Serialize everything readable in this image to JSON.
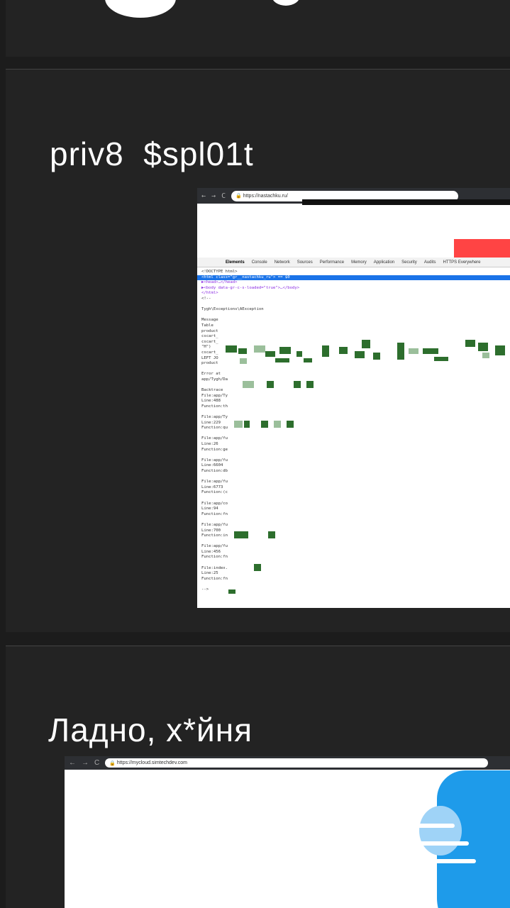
{
  "slide1": {
    "title": "priv8  $spl01t"
  },
  "slide2": {
    "title": "Ладно, х*йня"
  },
  "browser1": {
    "url": "https://nastachku.ru/",
    "devtools_tabs": [
      "Elements",
      "Console",
      "Network",
      "Sources",
      "Performance",
      "Memory",
      "Application",
      "Security",
      "Audits",
      "HTTPS Everywhere"
    ],
    "code_lines": [
      "<!DOCTYPE html>",
      "<html class=\"gr__nastachku_ru\"> == $0",
      "▶<head>…</head>",
      "▶<body data-gr-c-s-loaded=\"true\">…</body>",
      "</html>",
      "<!--",
      "",
      "Tygh\\Exceptions\\AException",
      "",
      "Message",
      "Table",
      "product",
      "cscart_",
      "cscart_",
      "\"H\")",
      "cscart_",
      "LEFT JO",
      "product",
      "",
      "Error at",
      "app/Tygh/Da",
      "",
      "Backtrace",
      "File:app/Ty",
      "Line:488",
      "Function:th",
      "",
      "File:app/Ty",
      "Line:229",
      "Function:qu",
      "",
      "File:app/fu",
      "Line:26",
      "Function:ge",
      "",
      "File:app/fu",
      "Line:6604",
      "Function:db",
      "",
      "File:app/fu",
      "Line:6773",
      "Function:(c",
      "",
      "File:app/co",
      "Line:94",
      "Function:fn",
      "",
      "File:app/fu",
      "Line:700",
      "Function:in",
      "",
      "File:app/fu",
      "Line:456",
      "Function:fn",
      "",
      "File:index.",
      "Line:25",
      "Function:fn",
      "",
      "-->"
    ]
  },
  "browser2": {
    "url": "https://mycloud.simtechdev.com"
  }
}
